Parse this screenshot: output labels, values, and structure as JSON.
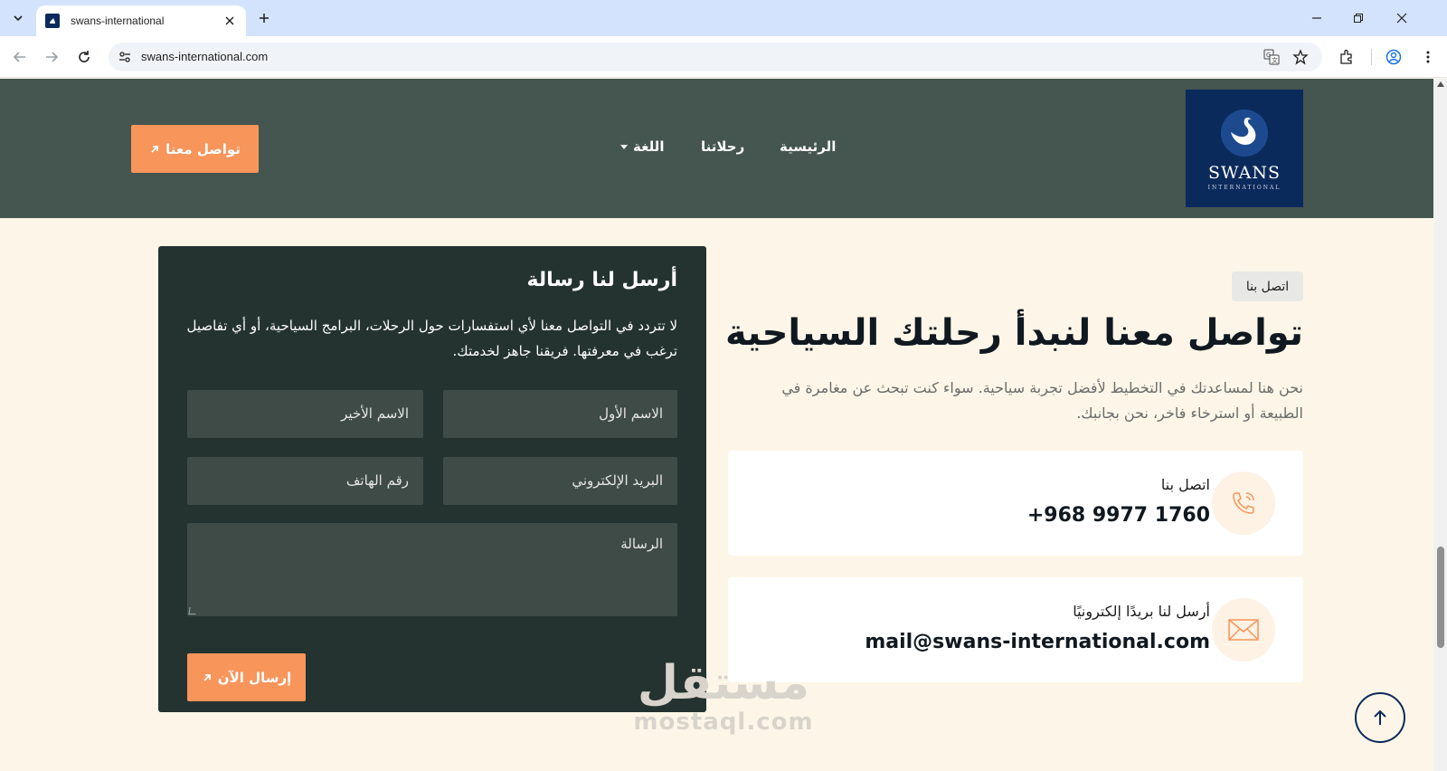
{
  "browser": {
    "tab_title": "swans-international",
    "url": "swans-international.com"
  },
  "header": {
    "logo_word": "SWANS",
    "logo_sub": "INTERNATIONAL",
    "nav": {
      "home": "الرئيسية",
      "trips": "رحلاتنا",
      "language": "اللغة"
    },
    "cta_label": "تواصل معنا"
  },
  "contact": {
    "badge": "اتصل بنا",
    "title": "تواصل معنا لنبدأ رحلتك السياحية",
    "description": "نحن هنا لمساعدتك في التخطيط لأفضل تجربة سياحية. سواء كنت تبحث عن مغامرة في الطبيعة أو استرخاء فاخر، نحن بجانبك.",
    "phone_card": {
      "label": "اتصل بنا",
      "value": "+968 9977 1760"
    },
    "email_card": {
      "label": "أرسل لنا بريدًا إلكترونيًا",
      "value": "mail@swans-international.com"
    }
  },
  "form": {
    "title": "أرسل لنا رسالة",
    "text": "لا تتردد في التواصل معنا لأي استفسارات حول الرحلات، البرامج السياحية، أو أي تفاصيل ترغب في معرفتها. فريقنا جاهز لخدمتك.",
    "first_name": "الاسم الأول",
    "last_name": "الاسم الأخير",
    "email": "البريد الإلكتروني",
    "phone": "رقم الهاتف",
    "message": "الرسالة",
    "submit": "إرسال الآن"
  },
  "watermark": {
    "ar": "مستقل",
    "en": "mostaql.com"
  },
  "colors": {
    "header_bg": "#455550",
    "accent": "#f7955b",
    "panel_bg": "#243330",
    "page_bg": "#fdf6e8",
    "brand_navy": "#0b2a5c"
  }
}
